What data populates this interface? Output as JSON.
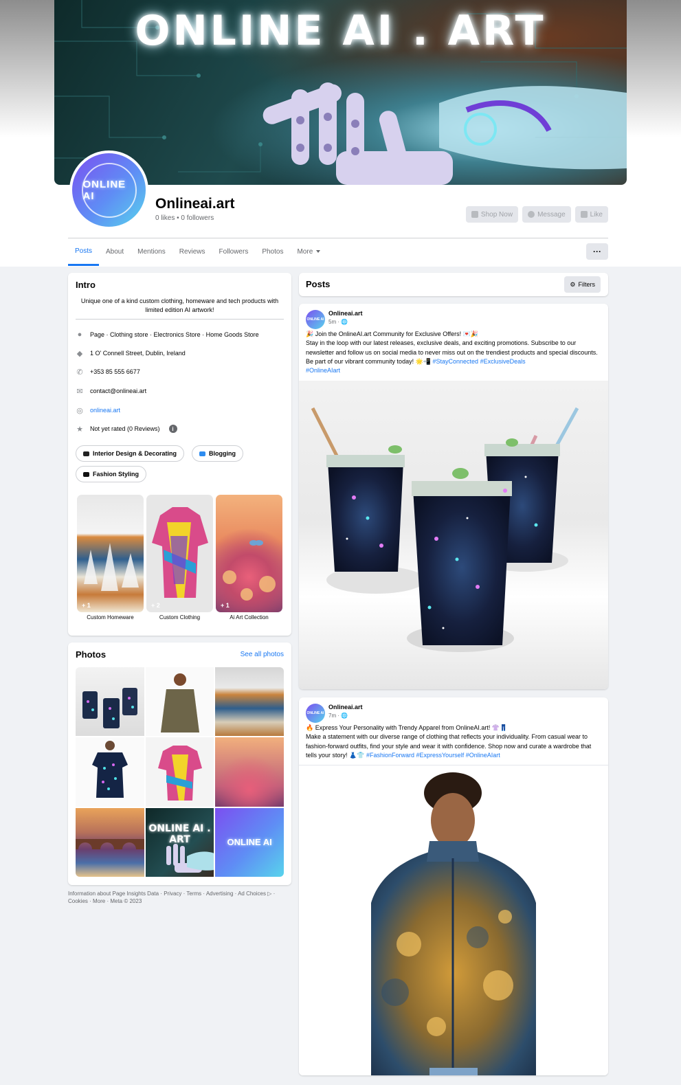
{
  "cover": {
    "title": "ONLINE AI . ART"
  },
  "avatar": {
    "text": "ONLINE AI"
  },
  "page": {
    "name": "Onlineai.art",
    "stats": "0 likes • 0 followers"
  },
  "actions": {
    "shop_now": "Shop Now",
    "message": "Message",
    "like": "Like"
  },
  "tabs": [
    {
      "label": "Posts"
    },
    {
      "label": "About"
    },
    {
      "label": "Mentions"
    },
    {
      "label": "Reviews"
    },
    {
      "label": "Followers"
    },
    {
      "label": "Photos"
    },
    {
      "label": "More"
    }
  ],
  "more_button": "···",
  "intro": {
    "title": "Intro",
    "bio": "Unique one of a kind custom clothing, homeware and tech products with limited edition AI artwork!",
    "category": "Page · Clothing store · Electronics Store · Home Goods Store",
    "address": "1 O' Connell Street, Dublin, Ireland",
    "phone": "+353 85 555 6677",
    "email": "contact@onlineai.art",
    "website": "onlineai.art",
    "rating": "Not yet rated (0 Reviews)",
    "interests": [
      "Interior Design & Decorating",
      "Blogging",
      "Fashion Styling"
    ],
    "featured": [
      {
        "label": "Custom Homeware",
        "badge": "+ 1"
      },
      {
        "label": "Custom Clothing",
        "badge": "+ 2"
      },
      {
        "label": "Ai Art Collection",
        "badge": "+ 1"
      }
    ]
  },
  "photos": {
    "title": "Photos",
    "see_all": "See all photos",
    "tile_text_1": "ONLINE AI . ART",
    "tile_text_2": "ONLINE AI"
  },
  "footer": {
    "line1": "Information about Page Insights Data · Privacy · Terms · Advertising · Ad Choices ▷ ·",
    "line2": "Cookies · More · Meta © 2023"
  },
  "posts_header": {
    "title": "Posts",
    "filters": "Filters"
  },
  "posts": [
    {
      "author": "Onlineai.art",
      "time": "5m · 🌐",
      "line1": "🎉 Join the OnlineAI.art Community for Exclusive Offers! 💌🎉",
      "body": "Stay in the loop with our latest releases, exclusive deals, and exciting promotions. Subscribe to our newsletter and follow us on social media to never miss out on the trendiest products and special discounts. Be part of our vibrant community today! 🌟📲",
      "tags_inline": "#StayConnected #ExclusiveDeals",
      "tags_next": "#OnlineAIart"
    },
    {
      "author": "Onlineai.art",
      "time": "7m · 🌐",
      "line1": "🔥 Express Your Personality with Trendy Apparel from OnlineAI.art! 👚👖",
      "body": "Make a statement with our diverse range of clothing that reflects your individuality. From casual wear to fashion-forward outfits, find your style and wear it with confidence. Shop now and curate a wardrobe that tells your story! 👗👕",
      "tags_inline": "#FashionForward #ExpressYourself #OnlineAIart"
    }
  ]
}
